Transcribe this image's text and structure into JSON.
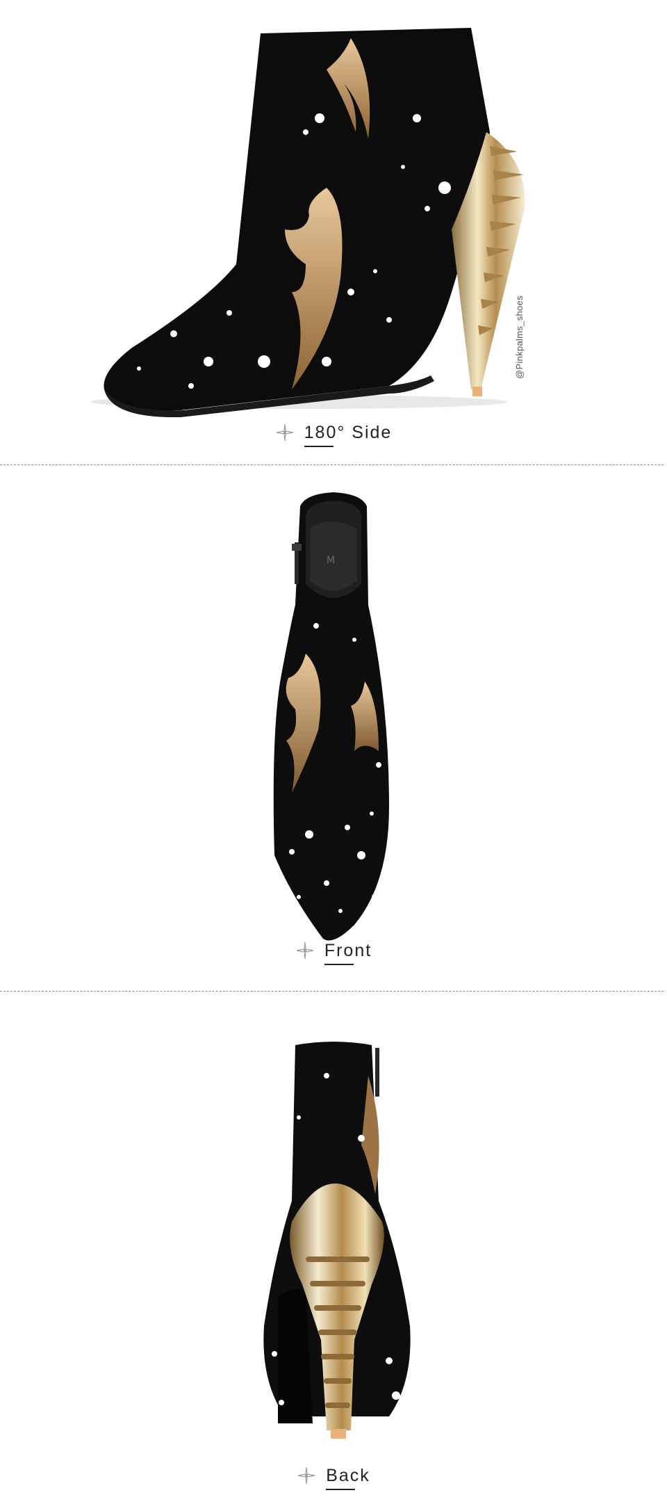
{
  "watermark": "@Pinkpalms_shoes",
  "views": [
    {
      "label": "180° Side"
    },
    {
      "label": "Front"
    },
    {
      "label": "Back"
    }
  ],
  "colors": {
    "suede": "#0c0c0c",
    "gold": "#c8a26a",
    "metal": "#d9c7a2",
    "splatter": "#ffffff",
    "divider": "#8c8c8c",
    "caption_text": "#222222"
  },
  "icons": {
    "caption_marker": "sparkle-icon"
  }
}
